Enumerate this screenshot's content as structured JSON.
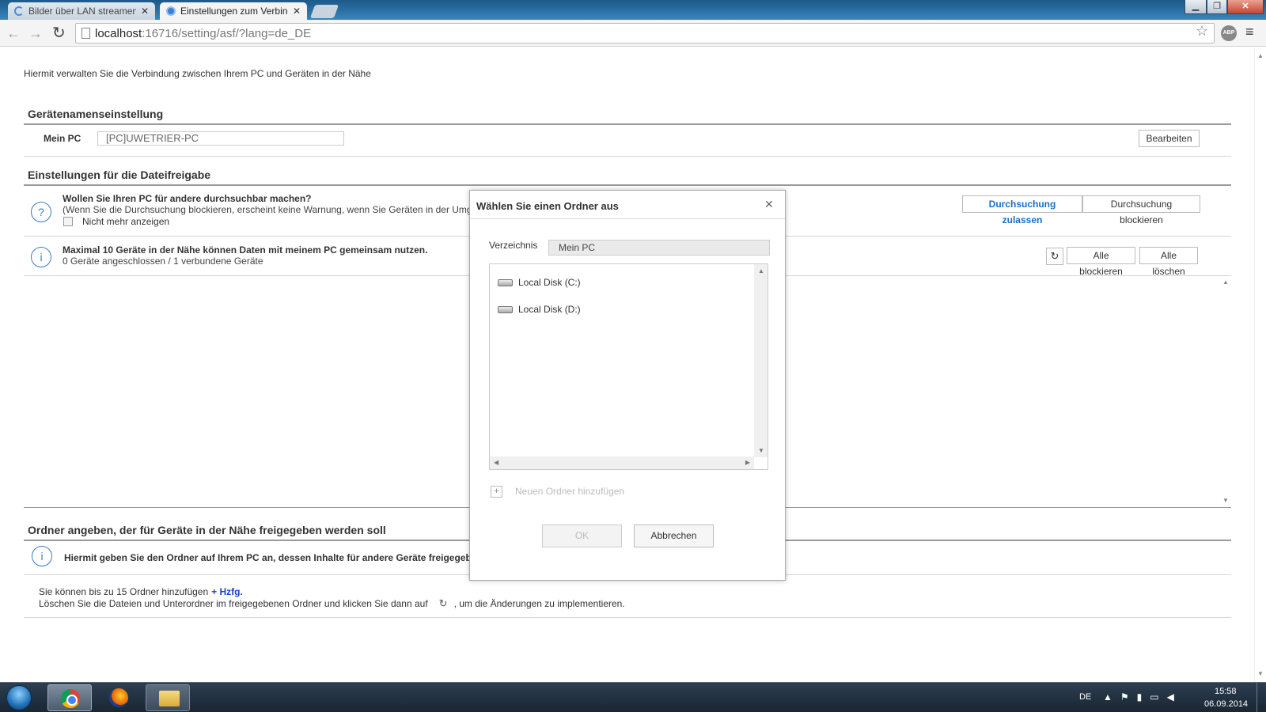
{
  "browser": {
    "tabs": [
      {
        "label": "Bilder über LAN streamen",
        "close": "✕"
      },
      {
        "label": "Einstellungen zum Verbindungs",
        "close": "✕"
      }
    ],
    "url_host": "localhost",
    "url_rest": ":16716/setting/asf/?lang=de_DE",
    "abp_label": "ABP"
  },
  "page": {
    "intro": "Hiermit verwalten Sie die Verbindung zwischen Ihrem PC und Geräten in der Nähe",
    "device_name_section": {
      "title": "Gerätenamenseinstellung",
      "label": "Mein PC",
      "value": "[PC]UWETRIER-PC",
      "edit_button": "Bearbeiten"
    },
    "sharing_section": {
      "title": "Einstellungen für die Dateifreigabe",
      "searchable": {
        "question": "Wollen Sie Ihren PC für andere durchsuchbar machen?",
        "description": "(Wenn Sie die Durchsuchung blockieren, erscheint keine Warnung, wenn Sie Geräten in der Umg",
        "checkbox_label": "Nicht mehr anzeigen",
        "allow_button": "Durchsuchung zulassen",
        "block_button": "Durchsuchung blockieren"
      },
      "devices": {
        "title": "Maximal 10 Geräte in der Nähe können Daten mit meinem PC gemeinsam nutzen.",
        "status": "0 Geräte angeschlossen / 1 verbundene Geräte",
        "block_all_button": "Alle blockieren",
        "delete_all_button": "Alle löschen"
      }
    },
    "folder_section": {
      "title": "Ordner angeben, der für Geräte in der Nähe freigegeben werden soll",
      "info": "Hiermit geben Sie den Ordner auf Ihrem PC an, dessen Inhalte für andere Geräte freigegeben",
      "hint_prefix": "Sie können bis zu 15 Ordner hinzufügen",
      "help_link": "+ Hzfg.",
      "hint2_before": "Löschen Sie die Dateien und Unterordner im freigegebenen Ordner und klicken Sie dann auf",
      "hint2_after": ", um die Änderungen zu implementieren."
    }
  },
  "modal": {
    "title": "Wählen Sie einen Ordner aus",
    "directory_label": "Verzeichnis",
    "directory_value": "Mein PC",
    "drives": [
      "Local Disk (C:)",
      "Local Disk (D:)"
    ],
    "add_folder": "Neuen Ordner hinzufügen",
    "ok": "OK",
    "cancel": "Abbrechen"
  },
  "taskbar": {
    "language": "DE",
    "time": "15:58",
    "date": "06.09.2014"
  },
  "colors": {
    "accent_blue": "#1a6fc4",
    "info_icon_blue": "#3b7cc7",
    "link_blue": "#1a3fc4"
  }
}
